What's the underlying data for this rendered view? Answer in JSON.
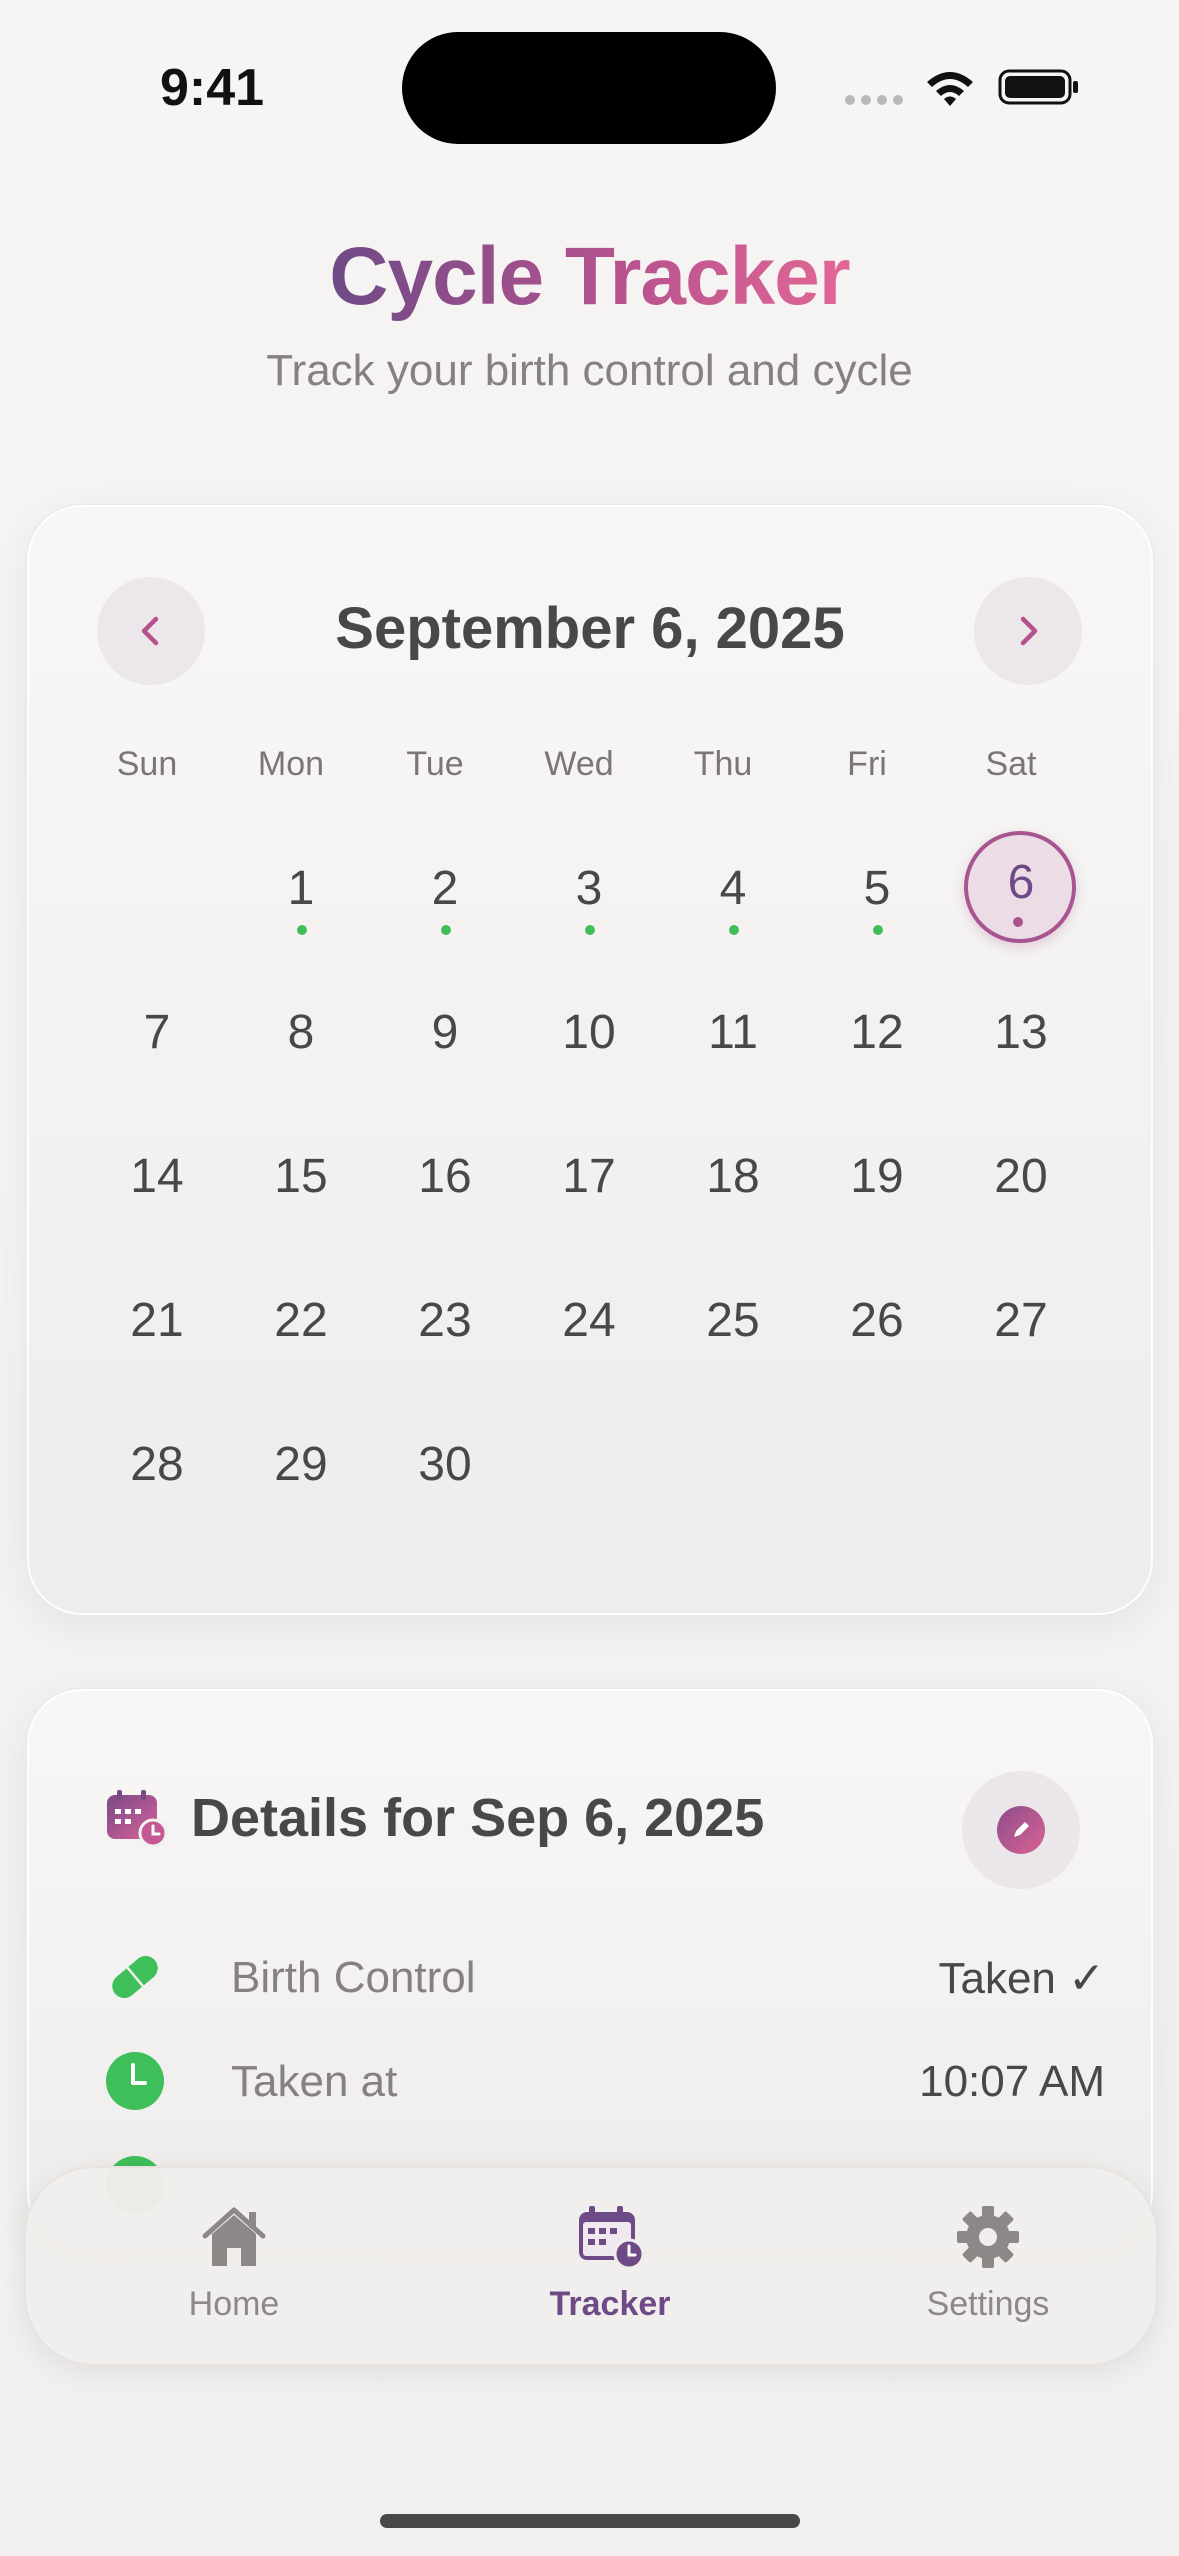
{
  "status_bar": {
    "time": "9:41"
  },
  "header": {
    "title": "Cycle Tracker",
    "subtitle": "Track your birth control and cycle"
  },
  "calendar": {
    "month_title": "September 6, 2025",
    "weekdays": [
      "Sun",
      "Mon",
      "Tue",
      "Wed",
      "Thu",
      "Fri",
      "Sat"
    ],
    "first_weekday_index": 1,
    "days_in_month": 30,
    "selected_day": 6,
    "taken_days": [
      1,
      2,
      3,
      4,
      5,
      6
    ],
    "colors": {
      "taken_dot": "#3fbf5a",
      "selected": "#a85490"
    }
  },
  "details": {
    "title": "Details for Sep 6, 2025",
    "rows": [
      {
        "icon": "pill-icon",
        "label": "Birth Control",
        "value": "Taken ✓"
      },
      {
        "icon": "clock-icon",
        "label": "Taken at",
        "value": "10:07 AM"
      }
    ]
  },
  "tab_bar": {
    "tabs": [
      {
        "icon": "house-icon",
        "label": "Home"
      },
      {
        "icon": "calendar-clock-icon",
        "label": "Tracker",
        "active": true
      },
      {
        "icon": "gear-icon",
        "label": "Settings"
      }
    ]
  },
  "colors": {
    "accent": "#6e4a87",
    "accent_pink": "#e26796",
    "success": "#3fbf5a",
    "text": "#4a4747"
  }
}
